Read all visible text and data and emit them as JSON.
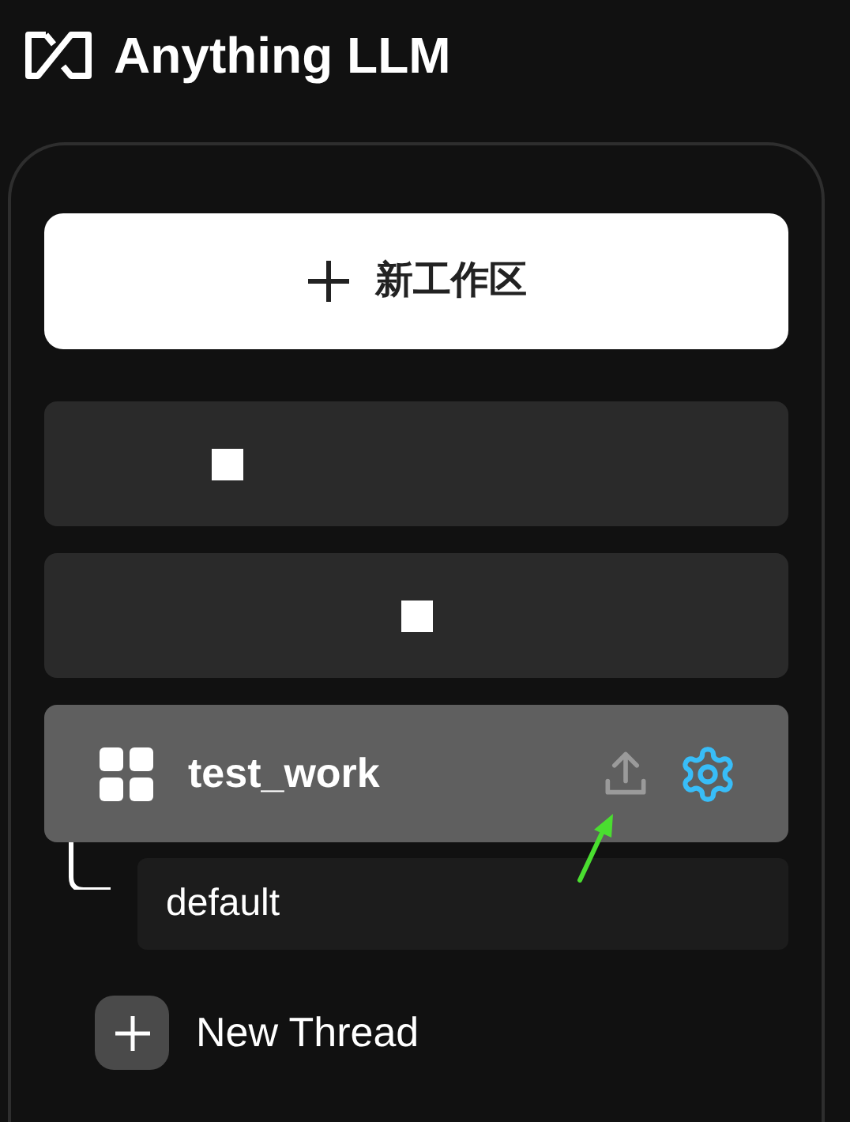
{
  "brand": {
    "name": "Anything LLM"
  },
  "new_workspace_button": {
    "label": "新工作区"
  },
  "workspaces": [
    {
      "kind": "redacted",
      "selected": false
    },
    {
      "kind": "redacted",
      "selected": false
    },
    {
      "kind": "named",
      "name": "test_work",
      "selected": true,
      "threads": [
        {
          "name": "default",
          "selected": false
        }
      ]
    }
  ],
  "new_thread": {
    "label": "New Thread"
  }
}
